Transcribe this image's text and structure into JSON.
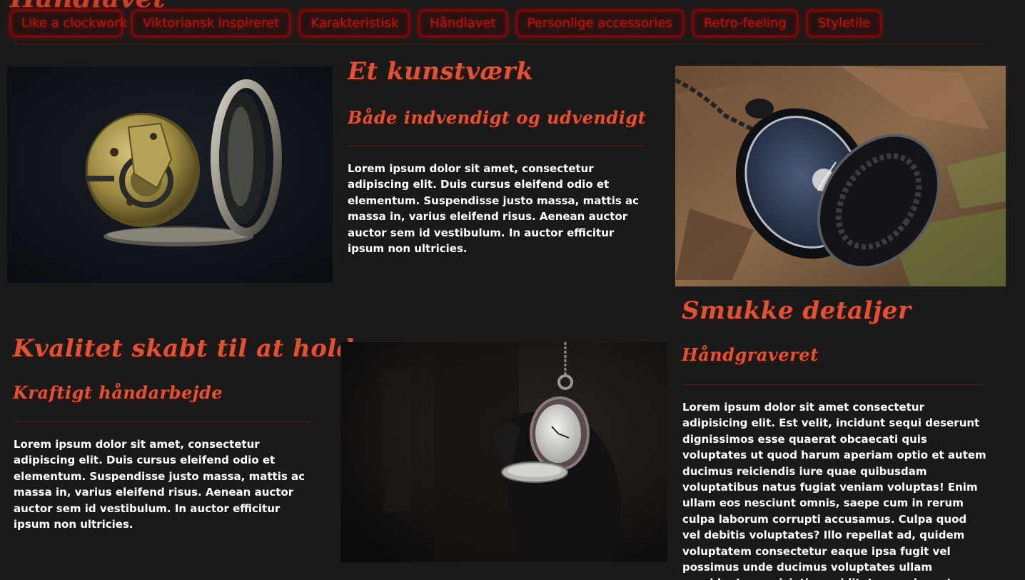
{
  "header": {
    "ghost_title": "Håndlavet"
  },
  "nav": {
    "items": [
      {
        "label": "Like a clockwork"
      },
      {
        "label": "Viktoriansk inspireret"
      },
      {
        "label": "Karakteristisk"
      },
      {
        "label": "Håndlavet"
      },
      {
        "label": "Personlige accessories"
      },
      {
        "label": "Retro-feeling"
      },
      {
        "label": "Styletile"
      }
    ]
  },
  "sections": {
    "kunstvaerk": {
      "title": "Et kunstværk",
      "subtitle": "Både indvendigt og udvendigt",
      "body": "Lorem ipsum dolor sit amet, consectetur adipiscing elit. Duis cursus eleifend odio et elementum. Suspendisse justo massa, mattis ac massa in, varius eleifend risus. Aenean auctor auctor sem id vestibulum. In auctor efficitur ipsum non ultricies."
    },
    "detaljer": {
      "title": "Smukke detaljer",
      "subtitle": "Håndgraveret",
      "body": "Lorem ipsum dolor sit amet consectetur adipisicing elit. Est velit, incidunt sequi deserunt dignissimos esse quaerat obcaecati quis voluptates ut quod harum aperiam optio et autem ducimus reiciendis iure quae quibusdam voluptatibus natus fugiat veniam voluptas! Enim ullam eos nesciunt omnis, saepe cum in rerum culpa laborum corrupti accusamus. Culpa quod vel debitis voluptates? Illo repellat ad, quidem voluptatem consectetur eaque ipsa fugit vel possimus unde ducimus voluptates ullam provident perspiciatis cupiditate nam inventore dicta, distinctio at aliquam eius!¢¢"
    },
    "kvalitet": {
      "title": "Kvalitet skabt til at holde",
      "subtitle": "Kraftigt håndarbejde",
      "body": "Lorem ipsum dolor sit amet, consectetur adipiscing elit. Duis cursus eleifend odio et elementum. Suspendisse justo massa, mattis ac massa in, varius eleifend risus. Aenean auctor auctor sem id vestibulum. In auctor efficitur ipsum non ultricies."
    }
  },
  "colors": {
    "background": "#1a1a1a",
    "heading": "#d9553a",
    "nav_glow": "#b00000",
    "body_text": "#ffffff"
  }
}
